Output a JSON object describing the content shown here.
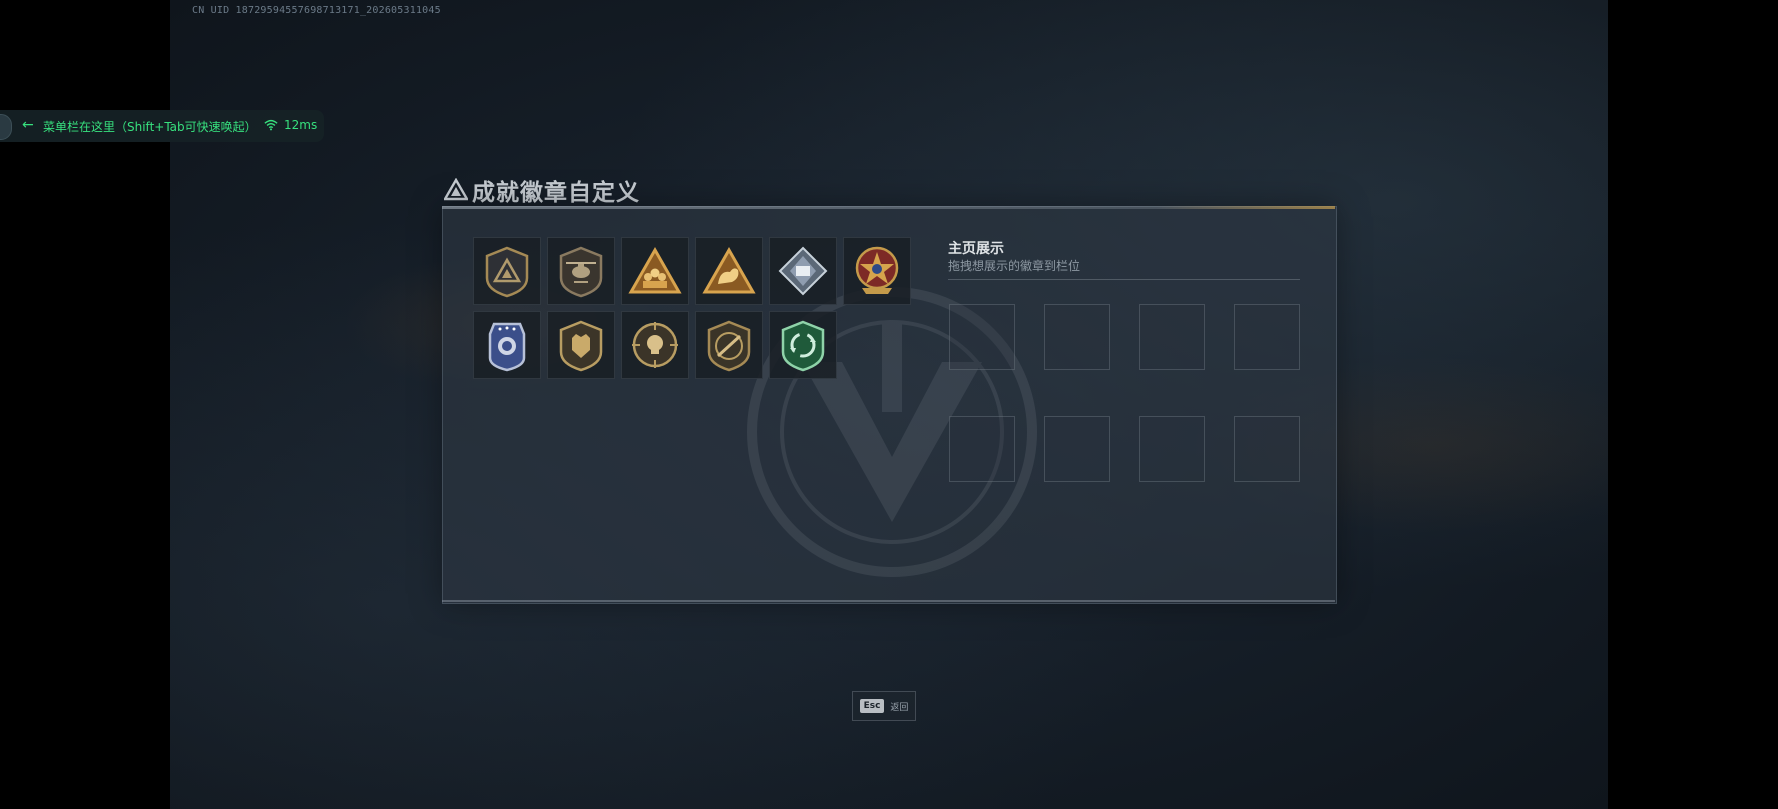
{
  "uid_text": "CN UID 18729594557698713171_202605311045",
  "menu_hint": {
    "text": "菜单栏在这里（Shift+Tab可快速唤起）",
    "ping": "12ms",
    "accent": "#37e07e"
  },
  "panel": {
    "title": "成就徽章自定义",
    "showcase_title": "主页展示",
    "showcase_subtitle": "拖拽想展示的徽章到栏位"
  },
  "badges": [
    {
      "icon": "triangle-shield-badge-icon"
    },
    {
      "icon": "helicopter-badge-icon"
    },
    {
      "icon": "gold-triangle-squad-badge-icon"
    },
    {
      "icon": "gold-triangle-muscle-badge-icon"
    },
    {
      "icon": "diamond-gem-badge-icon"
    },
    {
      "icon": "star-medal-badge-icon"
    },
    {
      "icon": "police-shield-badge-icon"
    },
    {
      "icon": "bear-shield-badge-icon"
    },
    {
      "icon": "skull-crosshair-badge-icon"
    },
    {
      "icon": "rifle-shield-badge-icon"
    },
    {
      "icon": "green-cycle-badge-icon"
    }
  ],
  "footer": {
    "esc_key": "Esc",
    "esc_label": "返回"
  }
}
